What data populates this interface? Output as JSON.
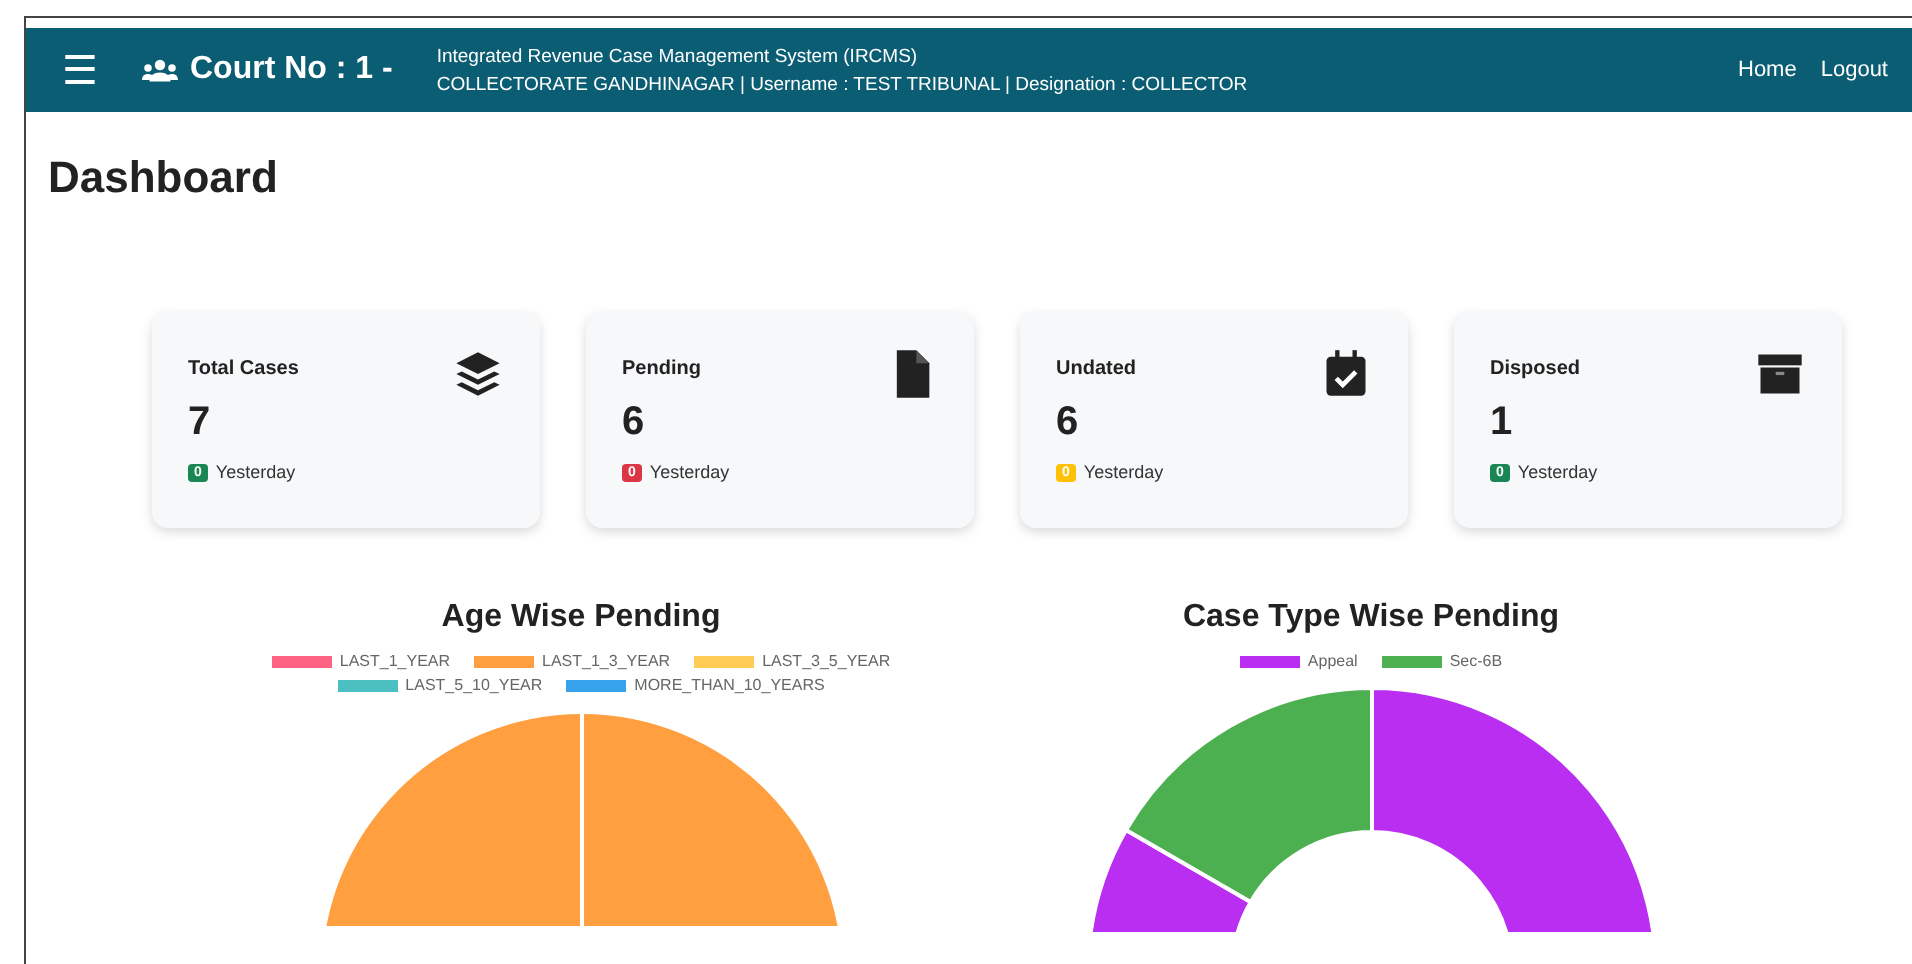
{
  "header": {
    "menu_icon": "☰",
    "court": "Court No : 1 -",
    "system_title": "Integrated Revenue Case Management System (IRCMS)",
    "subtitle": "COLLECTORATE GANDHINAGAR | Username : TEST TRIBUNAL | Designation : COLLECTOR",
    "links": [
      "Home",
      "Logout"
    ]
  },
  "page_title": "Dashboard",
  "cards": [
    {
      "title": "Total Cases",
      "value": "7",
      "badge": {
        "text": "0",
        "color": "#198754"
      },
      "note": "Yesterday",
      "kind": "layers"
    },
    {
      "title": "Pending",
      "value": "6",
      "badge": {
        "text": "0",
        "color": "#dc3545"
      },
      "note": "Yesterday",
      "kind": "file"
    },
    {
      "title": "Undated",
      "value": "6",
      "badge": {
        "text": "0",
        "color": "#ffc107"
      },
      "note": "Yesterday",
      "kind": "calendar"
    },
    {
      "title": "Disposed",
      "value": "1",
      "badge": {
        "text": "0",
        "color": "#198754"
      },
      "note": "Yesterday",
      "kind": "archive"
    }
  ],
  "charts": [
    {
      "title": "Age Wise Pending",
      "kind": "pie",
      "legend": [
        {
          "label": "LAST_1_YEAR",
          "color": "#ff6384"
        },
        {
          "label": "LAST_1_3_YEAR",
          "color": "#ff9f40"
        },
        {
          "label": "LAST_3_5_YEAR",
          "color": "#ffcd56"
        },
        {
          "label": "LAST_5_10_YEAR",
          "color": "#4bc0c0"
        },
        {
          "label": "MORE_THAN_10_YEARS",
          "color": "#36a2eb"
        }
      ]
    },
    {
      "title": "Case Type Wise Pending",
      "kind": "donut",
      "legend": [
        {
          "label": "Appeal",
          "color": "#b92ef0"
        },
        {
          "label": "Sec-6B",
          "color": "#4caf50"
        }
      ]
    }
  ]
}
